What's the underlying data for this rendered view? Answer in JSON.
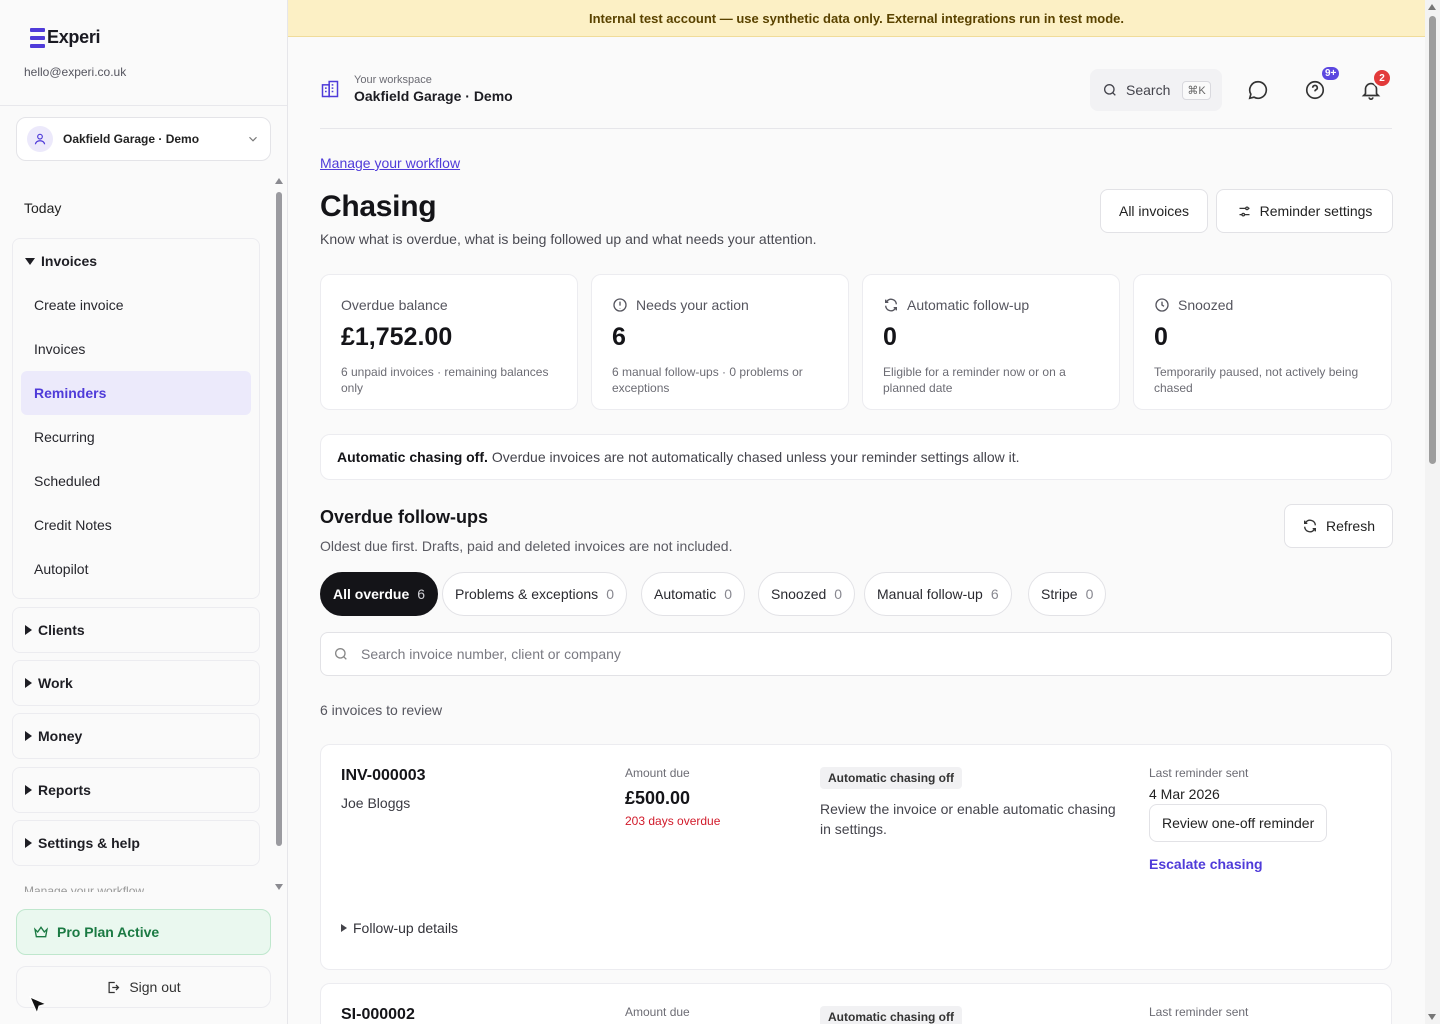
{
  "sidebar": {
    "brand": "Experi",
    "email": "hello@experi.co.uk",
    "workspace_select": "Oakfield Garage · Demo",
    "today": "Today",
    "invoices_group": "Invoices",
    "invoice_items": [
      "Create invoice",
      "Invoices",
      "Reminders",
      "Recurring",
      "Scheduled",
      "Credit Notes",
      "Autopilot"
    ],
    "active_item": "Reminders",
    "groups": [
      "Clients",
      "Work",
      "Money",
      "Reports",
      "Settings & help"
    ],
    "faded_link": "Manage your workflow",
    "pro_plan": "Pro Plan Active",
    "sign_out": "Sign out"
  },
  "banner": "Internal test account — use synthetic data only. External integrations run in test mode.",
  "header": {
    "workspace_caption": "Your workspace",
    "workspace_name": "Oakfield Garage · Demo",
    "search_label": "Search",
    "search_shortcut": "⌘K",
    "help_badge": "9+",
    "notifications_badge": "2"
  },
  "page": {
    "workflow_link": "Manage your workflow",
    "title": "Chasing",
    "subtitle": "Know what is overdue, what is being followed up and what needs your attention.",
    "all_invoices_btn": "All invoices",
    "reminder_settings_btn": "Reminder settings"
  },
  "stats": [
    {
      "label": "Overdue balance",
      "value": "£1,752.00",
      "note": "6 unpaid invoices · remaining balances only",
      "icon": "none"
    },
    {
      "label": "Needs your action",
      "value": "6",
      "note": "6 manual follow-ups · 0 problems or exceptions",
      "icon": "alert-circle-icon"
    },
    {
      "label": "Automatic follow-up",
      "value": "0",
      "note": "Eligible for a reminder now or on a planned date",
      "icon": "refresh-icon"
    },
    {
      "label": "Snoozed",
      "value": "0",
      "note": "Temporarily paused, not actively being chased",
      "icon": "clock-icon"
    }
  ],
  "notice": {
    "bold": "Automatic chasing off.",
    "text": "Overdue invoices are not automatically chased unless your reminder settings allow it."
  },
  "followups": {
    "title": "Overdue follow-ups",
    "subtitle": "Oldest due first. Drafts, paid and deleted invoices are not included.",
    "refresh_btn": "Refresh",
    "filters": [
      {
        "label": "All overdue",
        "count": "6"
      },
      {
        "label": "Problems & exceptions",
        "count": "0"
      },
      {
        "label": "Automatic",
        "count": "0"
      },
      {
        "label": "Snoozed",
        "count": "0"
      },
      {
        "label": "Manual follow-up",
        "count": "6"
      },
      {
        "label": "Stripe",
        "count": "0"
      }
    ],
    "search_placeholder": "Search invoice number, client or company",
    "count_line": "6 invoices to review"
  },
  "invoices": [
    {
      "number": "INV-000003",
      "client": "Joe Bloggs",
      "amount_label": "Amount due",
      "amount": "£500.00",
      "overdue": "203 days overdue",
      "status": "Automatic chasing off",
      "status_text": "Review the invoice or enable automatic chasing in settings.",
      "last_label": "Last reminder sent",
      "last_date": "4 Mar 2026",
      "review_btn": "Review one-off reminder",
      "escalate": "Escalate chasing",
      "details": "Follow-up details"
    },
    {
      "number": "SI-000002",
      "amount_label": "Amount due",
      "status": "Automatic chasing off",
      "last_label": "Last reminder sent"
    }
  ],
  "colors": {
    "accent": "#4f3bd9",
    "banner_bg": "#fcf0c5",
    "overdue_red": "#d11a2a",
    "pro_green": "#1b7a43"
  }
}
